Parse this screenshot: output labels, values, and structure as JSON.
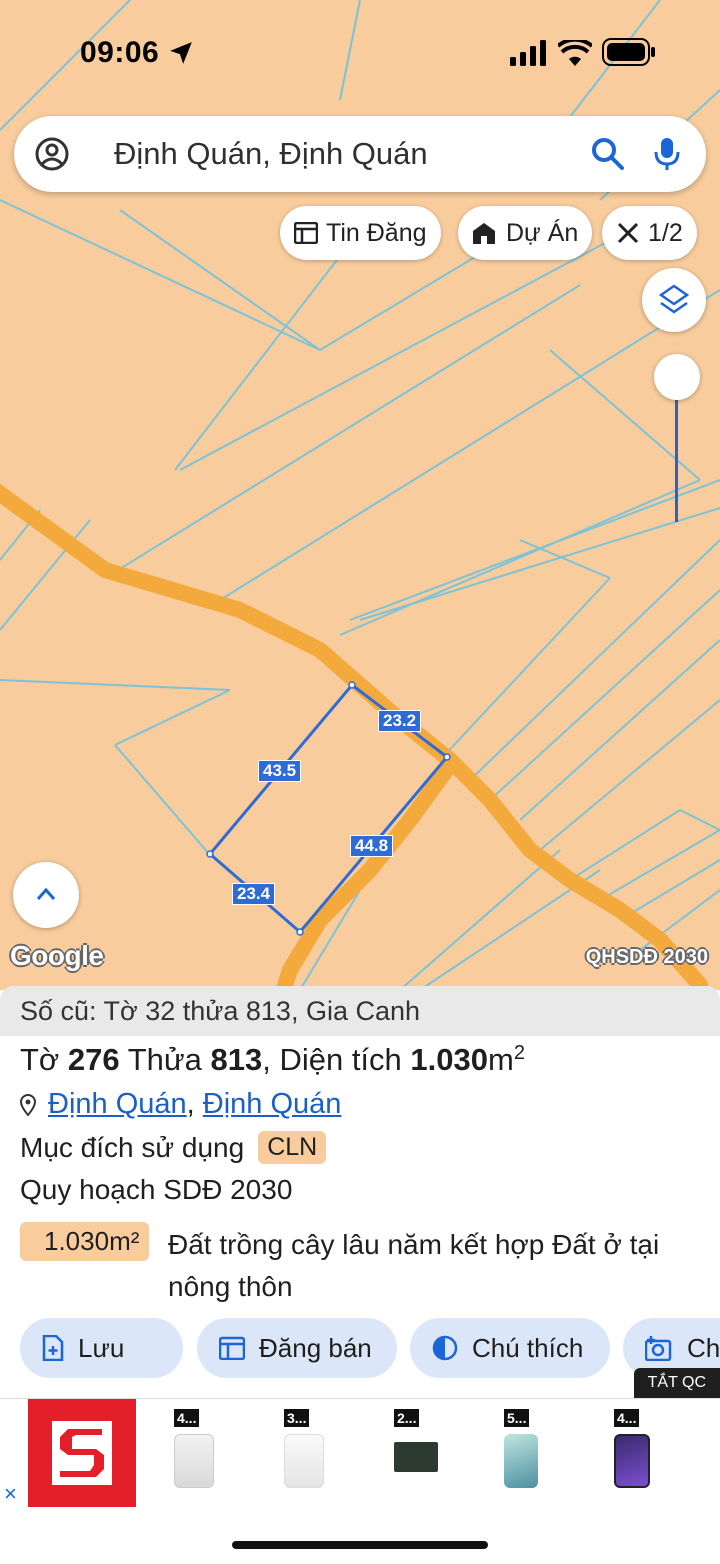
{
  "status_bar": {
    "time": "09:06"
  },
  "search": {
    "query": "Định Quán, Định Quán"
  },
  "chips": [
    {
      "label": "Tin Đăng",
      "icon": "listing-icon"
    },
    {
      "label": "Dự Án",
      "icon": "project-house-icon"
    },
    {
      "label": "1/2",
      "icon": "ruler-compass-icon"
    }
  ],
  "map": {
    "attribution": "Google",
    "layer_label": "QHSDĐ 2030",
    "edge_lengths": [
      "23.2",
      "43.5",
      "44.8",
      "23.4"
    ],
    "colors": {
      "land": "#f8cc9c",
      "road": "#f4a93c",
      "boundary": "#7cc3d8",
      "parcel": "#2f6bd4"
    }
  },
  "sheet": {
    "old_reference": "Số cũ: Tờ 32 thửa 813, Gia Canh",
    "to_label": "Tờ",
    "to_value": "276",
    "thua_label": "Thửa",
    "thua_value": "813",
    "area_label": ", Diện tích",
    "area_value": "1.030",
    "area_unit": "m",
    "area_sup": "2",
    "location_1": "Định Quán",
    "location_sep": ",",
    "location_2": "Định Quán",
    "purpose_label": "Mục đích sử dụng",
    "purpose_code": "CLN",
    "plan_label": "Quy hoạch SDĐ 2030",
    "plan_area": "1.030m²",
    "plan_desc": "Đất trồng cây lâu năm kết hợp Đất ở tại nông thôn",
    "actions": [
      "Lưu",
      "Đăng bán",
      "Chú thích",
      "Ch"
    ]
  },
  "ad": {
    "close": "TẮT QC",
    "close_x": "×",
    "products": [
      "4...",
      "3...",
      "2...",
      "5...",
      "4..."
    ]
  }
}
